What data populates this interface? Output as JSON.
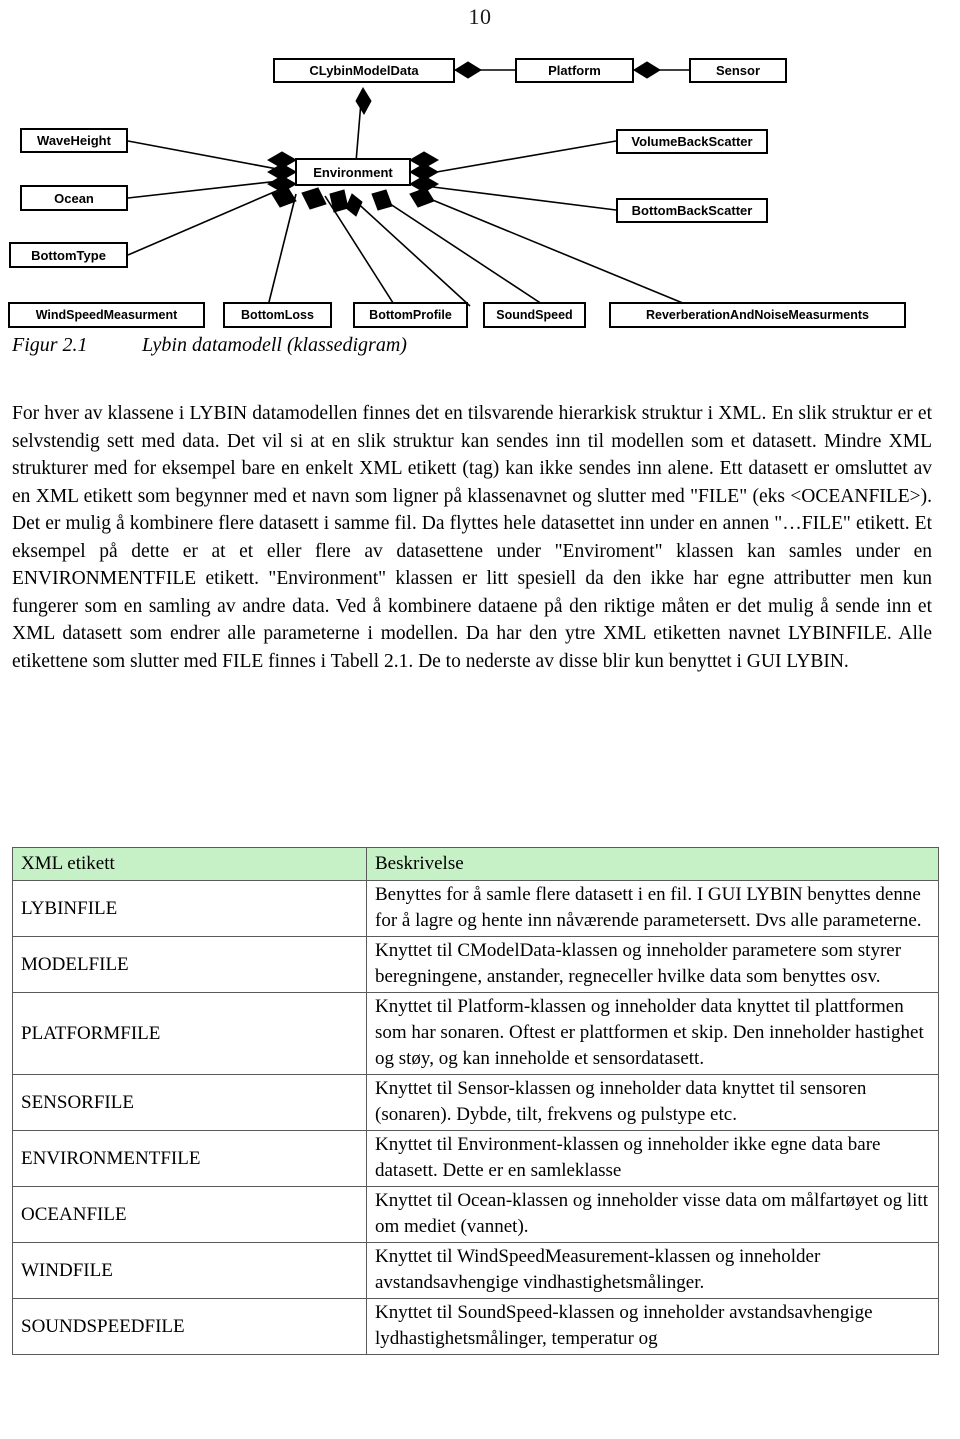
{
  "page": {
    "number": "10"
  },
  "figure": {
    "label": "Figur 2.1",
    "title": "Lybin datamodell (klassedigram)",
    "diagram": {
      "classes": {
        "model_data": "CLybinModelData",
        "platform": "Platform",
        "sensor": "Sensor",
        "environment": "Environment",
        "wave_height": "WaveHeight",
        "ocean": "Ocean",
        "bottom_type": "BottomType",
        "volume_back_scatter": "VolumeBackScatter",
        "bottom_back_scatter": "BottomBackScatter",
        "wind_speed_measurment": "WindSpeedMeasurment",
        "bottom_loss": "BottomLoss",
        "bottom_profile": "BottomProfile",
        "sound_speed": "SoundSpeed",
        "reverberation": "ReverberationAndNoiseMeasurments"
      }
    }
  },
  "body": {
    "paragraph": "For hver av klassene i LYBIN datamodellen finnes det en tilsvarende hierarkisk struktur i XML. En slik struktur er et selvstendig sett med data. Det vil si at en slik struktur kan sendes inn til modellen som et datasett. Mindre XML strukturer med for eksempel bare en enkelt XML etikett (tag) kan ikke sendes inn alene. Ett datasett er omsluttet av en XML etikett som begynner med et navn som ligner på klassenavnet og slutter med \"FILE\" (eks <OCEANFILE>). Det er mulig å kombinere flere datasett i samme fil. Da flyttes hele datasettet inn under en annen \"…FILE\" etikett. Et eksempel på dette er at et eller flere av datasettene under \"Enviroment\" klassen kan samles under en ENVIRONMENTFILE etikett. \"Environment\" klassen er litt spesiell da den ikke har egne attributter men kun fungerer som en samling av andre data. Ved å kombinere dataene på den riktige måten er det mulig å sende inn et XML datasett som endrer alle parameterne i modellen. Da har den ytre XML etiketten navnet LYBINFILE. Alle etikettene som slutter med FILE finnes i Tabell 2.1. De to nederste av disse blir kun benyttet i GUI LYBIN."
  },
  "table": {
    "headers": [
      "XML etikett",
      "Beskrivelse"
    ],
    "rows": [
      {
        "tag": "LYBINFILE",
        "description": "Benyttes for å samle flere datasett i en fil. I GUI LYBIN benyttes denne for å lagre og hente inn nåværende parametersett. Dvs alle parameterne."
      },
      {
        "tag": "MODELFILE",
        "description": "Knyttet til CModelData-klassen og inneholder parametere som styrer beregningene, anstander, regneceller hvilke data som benyttes osv."
      },
      {
        "tag": "PLATFORMFILE",
        "description": "Knyttet til Platform-klassen og inneholder data knyttet til plattformen som har sonaren. Oftest er plattformen et skip. Den inneholder hastighet og støy, og kan inneholde et sensordatasett."
      },
      {
        "tag": "SENSORFILE",
        "description": "Knyttet til Sensor-klassen og inneholder data knyttet til sensoren (sonaren). Dybde, tilt, frekvens og pulstype etc."
      },
      {
        "tag": "ENVIRONMENTFILE",
        "description": "Knyttet til Environment-klassen og inneholder ikke egne data bare datasett. Dette er en samleklasse"
      },
      {
        "tag": "OCEANFILE",
        "description": "Knyttet til Ocean-klassen og inneholder visse data om målfartøyet og litt om mediet (vannet)."
      },
      {
        "tag": "WINDFILE",
        "description": "Knyttet til WindSpeedMeasurement-klassen og inneholder avstandsavhengige vindhastighetsmålinger."
      },
      {
        "tag": "SOUNDSPEEDFILE",
        "description": "Knyttet til SoundSpeed-klassen og inneholder avstandsavhengige lydhastighetsmålinger, temperatur og"
      }
    ]
  },
  "colors": {
    "table_header_background": "#c6f0c6",
    "table_border": "#5a5a5a",
    "diagram_line": "#000000"
  }
}
